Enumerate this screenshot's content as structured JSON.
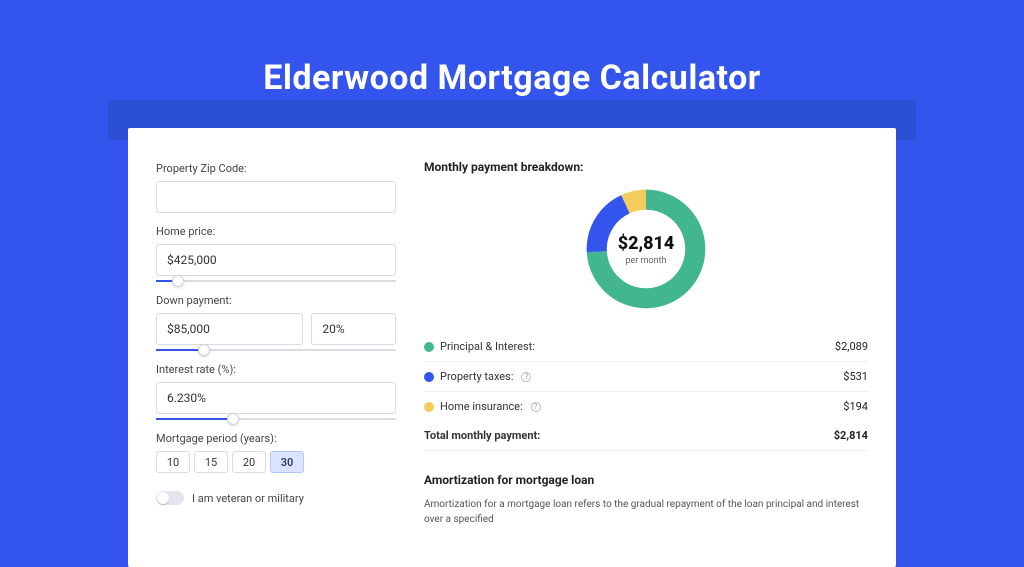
{
  "title": "Elderwood Mortgage Calculator",
  "form": {
    "zip_label": "Property Zip Code:",
    "zip_value": "",
    "price_label": "Home price:",
    "price_value": "$425,000",
    "price_slider_pct": 9,
    "down_label": "Down payment:",
    "down_amount": "$85,000",
    "down_pct": "20%",
    "down_slider_pct": 20,
    "rate_label": "Interest rate (%):",
    "rate_value": "6.230%",
    "rate_slider_pct": 32,
    "period_label": "Mortgage period (years):",
    "periods": [
      "10",
      "15",
      "20",
      "30"
    ],
    "period_active": 3,
    "vet_label": "I am veteran or military"
  },
  "breakdown": {
    "title": "Monthly payment breakdown:",
    "center_amount": "$2,814",
    "center_sub": "per month",
    "items": [
      {
        "label": "Principal & Interest:",
        "value": "$2,089",
        "color": "#42b690",
        "pct": 74,
        "info": false
      },
      {
        "label": "Property taxes:",
        "value": "$531",
        "color": "#3355ee",
        "pct": 19,
        "info": true
      },
      {
        "label": "Home insurance:",
        "value": "$194",
        "color": "#f2cd5d",
        "pct": 7,
        "info": true
      }
    ],
    "total_label": "Total monthly payment:",
    "total_value": "$2,814"
  },
  "amort": {
    "title": "Amortization for mortgage loan",
    "body": "Amortization for a mortgage loan refers to the gradual repayment of the loan principal and interest over a specified"
  },
  "chart_data": {
    "type": "pie",
    "title": "Monthly payment breakdown",
    "series": [
      {
        "name": "Principal & Interest",
        "value": 2089,
        "color": "#42b690"
      },
      {
        "name": "Property taxes",
        "value": 531,
        "color": "#3355ee"
      },
      {
        "name": "Home insurance",
        "value": 194,
        "color": "#f2cd5d"
      }
    ],
    "total": 2814,
    "center_label": "$2,814 per month"
  }
}
